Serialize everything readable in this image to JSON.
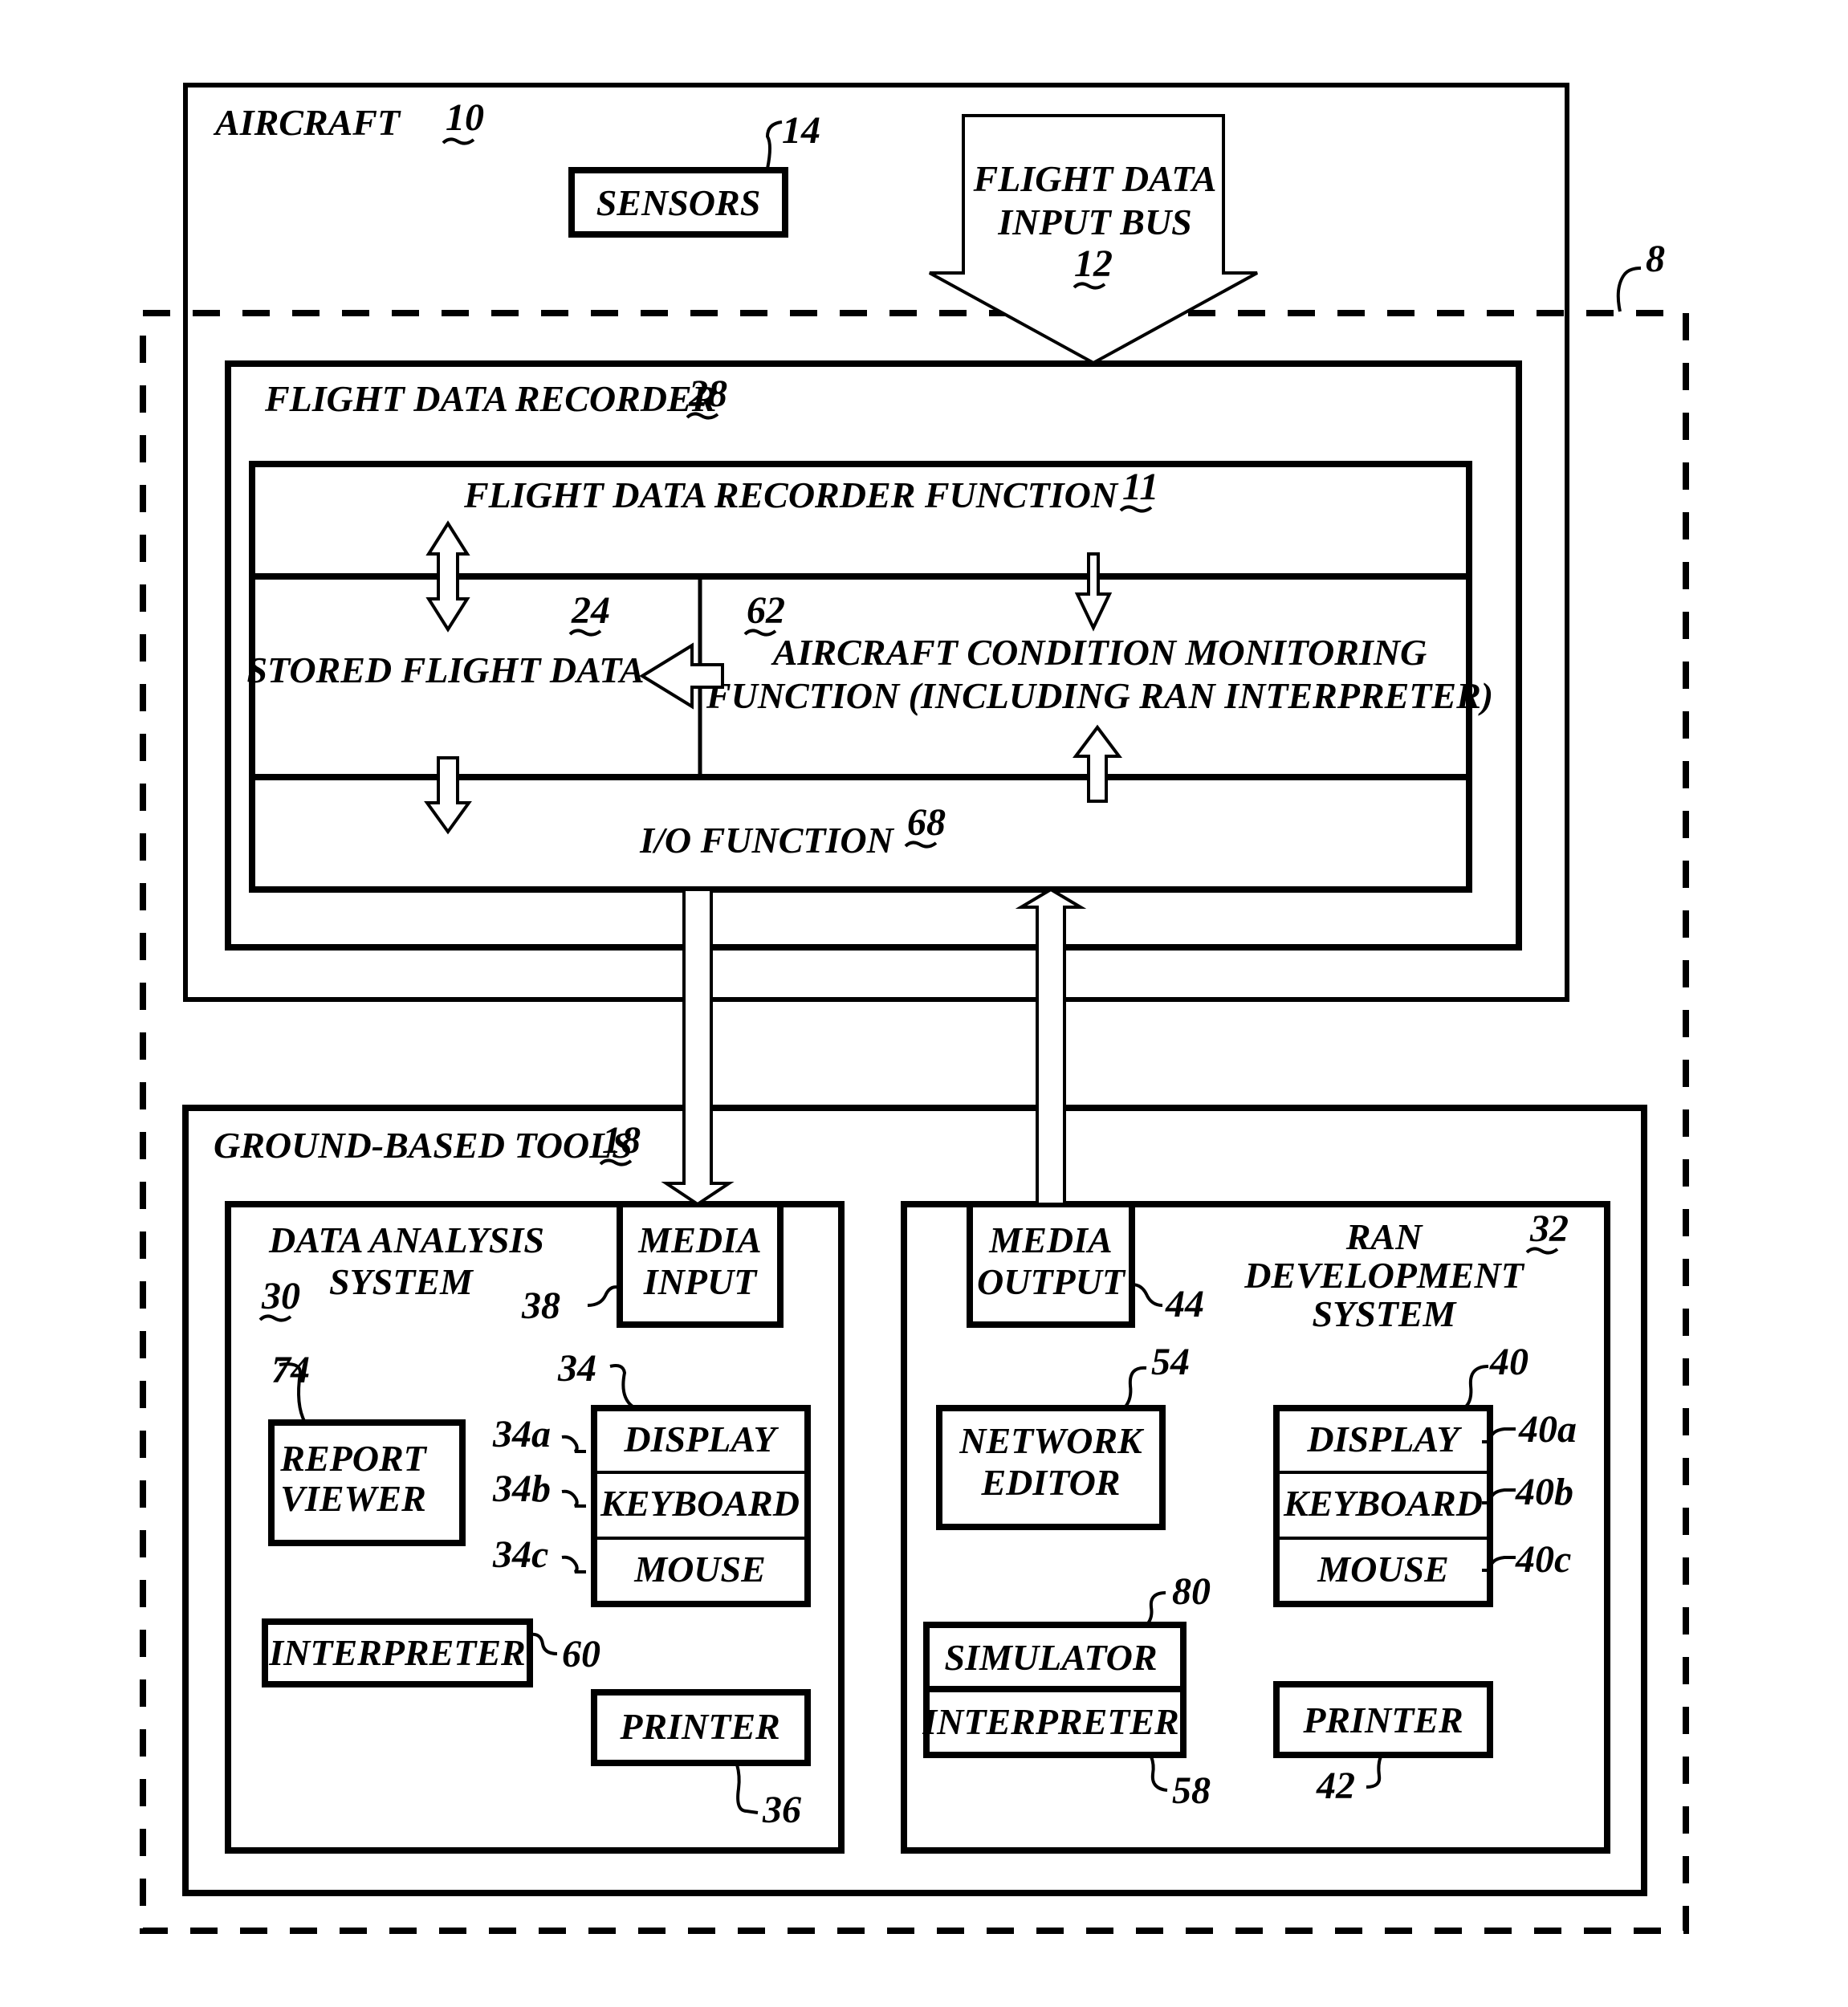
{
  "figure": {
    "system_ref": "8",
    "aircraft": {
      "label": "AIRCRAFT",
      "ref": "10"
    },
    "sensors": {
      "label": "SENSORS",
      "ref": "14"
    },
    "bus": {
      "line1": "FLIGHT DATA",
      "line2": "INPUT BUS",
      "ref": "12"
    },
    "fdr": {
      "label": "FLIGHT DATA RECORDER",
      "ref": "28"
    },
    "fdr_function": {
      "label": "FLIGHT DATA RECORDER FUNCTION",
      "ref": "11"
    },
    "stored": {
      "label": "STORED FLIGHT DATA",
      "ref": "24"
    },
    "acm": {
      "line1": "AIRCRAFT CONDITION  MONITORING",
      "line2": "FUNCTION (INCLUDING RAN INTERPRETER)",
      "ref": "62"
    },
    "io": {
      "label": "I/O FUNCTION",
      "ref": "68"
    },
    "ground": {
      "label": "GROUND-BASED TOOLS",
      "ref": "18"
    },
    "das": {
      "line1": "DATA ANALYSIS",
      "line2": "SYSTEM",
      "ref": "30",
      "media_input": {
        "line1": "MEDIA",
        "line2": "INPUT",
        "ref": "38"
      },
      "report_viewer": {
        "line1": "REPORT",
        "line2": "VIEWER",
        "ref": "74"
      },
      "io_group_ref": "34",
      "display": {
        "label": "DISPLAY",
        "ref": "34a"
      },
      "keyboard": {
        "label": "KEYBOARD",
        "ref": "34b"
      },
      "mouse": {
        "label": "MOUSE",
        "ref": "34c"
      },
      "interpreter": {
        "label": "INTERPRETER",
        "ref": "60"
      },
      "printer": {
        "label": "PRINTER",
        "ref": "36"
      }
    },
    "ran": {
      "line1": "RAN",
      "line2": "DEVELOPMENT",
      "line3": "SYSTEM",
      "ref": "32",
      "media_output": {
        "line1": "MEDIA",
        "line2": "OUTPUT",
        "ref": "44"
      },
      "network_editor": {
        "line1": "NETWORK",
        "line2": "EDITOR",
        "ref": "54"
      },
      "io_group_ref": "40",
      "display": {
        "label": "DISPLAY",
        "ref": "40a"
      },
      "keyboard": {
        "label": "KEYBOARD",
        "ref": "40b"
      },
      "mouse": {
        "label": "MOUSE",
        "ref": "40c"
      },
      "simulator": {
        "label": "SIMULATOR",
        "ref": "80"
      },
      "interpreter": {
        "label": "INTERPRETER",
        "ref": "58"
      },
      "printer": {
        "label": "PRINTER",
        "ref": "42"
      }
    }
  }
}
